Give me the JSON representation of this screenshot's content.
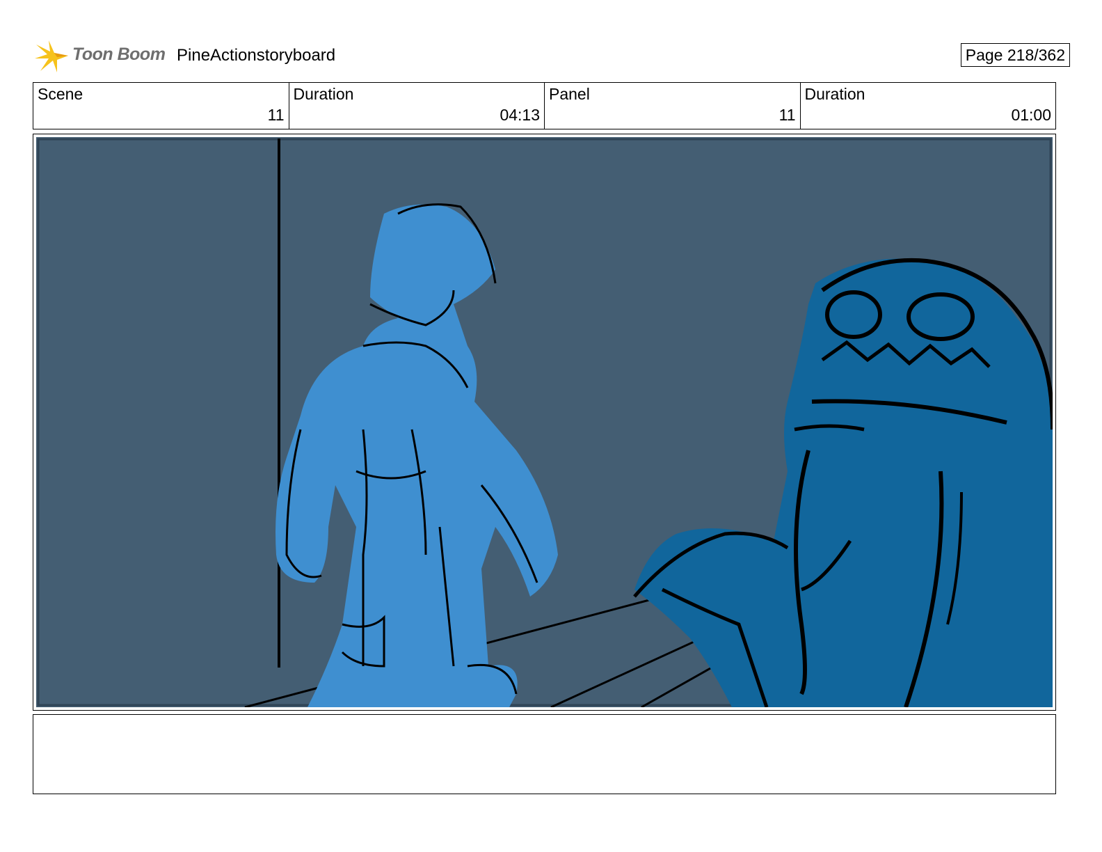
{
  "header": {
    "logo_text": "Toon Boom",
    "project_title": "PineActionstoryboard",
    "page_label": "Page 218/362"
  },
  "info": {
    "scene": {
      "label": "Scene",
      "value": "11"
    },
    "scene_duration": {
      "label": "Duration",
      "value": "04:13"
    },
    "panel": {
      "label": "Panel",
      "value": "11"
    },
    "panel_duration": {
      "label": "Duration",
      "value": "01:00"
    }
  },
  "colors": {
    "background": "#445e73",
    "hero_fill": "#3f8fd0",
    "monster_fill": "#11669c",
    "ink": "#000000",
    "logo_star": "#f6c21b"
  },
  "icons": [
    "toon-boom-star-icon"
  ]
}
